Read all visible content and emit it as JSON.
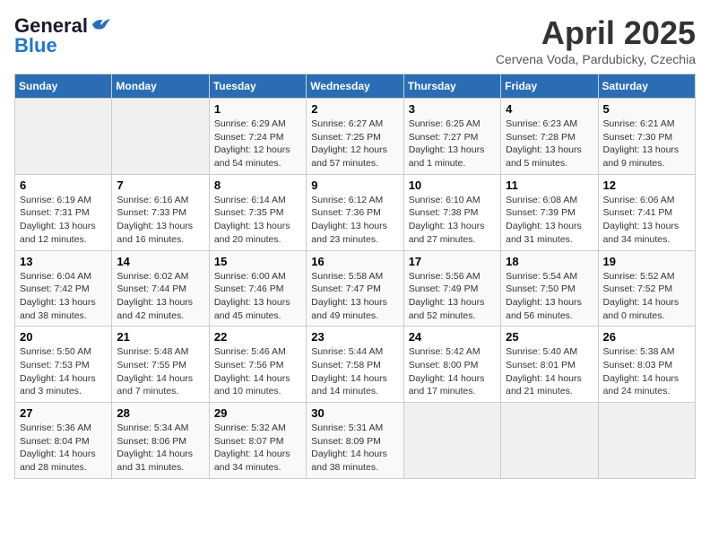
{
  "header": {
    "logo_general": "General",
    "logo_blue": "Blue",
    "title": "April 2025",
    "location": "Cervena Voda, Pardubicky, Czechia"
  },
  "days_of_week": [
    "Sunday",
    "Monday",
    "Tuesday",
    "Wednesday",
    "Thursday",
    "Friday",
    "Saturday"
  ],
  "weeks": [
    [
      {
        "day": "",
        "info": ""
      },
      {
        "day": "",
        "info": ""
      },
      {
        "day": "1",
        "info": "Sunrise: 6:29 AM\nSunset: 7:24 PM\nDaylight: 12 hours and 54 minutes."
      },
      {
        "day": "2",
        "info": "Sunrise: 6:27 AM\nSunset: 7:25 PM\nDaylight: 12 hours and 57 minutes."
      },
      {
        "day": "3",
        "info": "Sunrise: 6:25 AM\nSunset: 7:27 PM\nDaylight: 13 hours and 1 minute."
      },
      {
        "day": "4",
        "info": "Sunrise: 6:23 AM\nSunset: 7:28 PM\nDaylight: 13 hours and 5 minutes."
      },
      {
        "day": "5",
        "info": "Sunrise: 6:21 AM\nSunset: 7:30 PM\nDaylight: 13 hours and 9 minutes."
      }
    ],
    [
      {
        "day": "6",
        "info": "Sunrise: 6:19 AM\nSunset: 7:31 PM\nDaylight: 13 hours and 12 minutes."
      },
      {
        "day": "7",
        "info": "Sunrise: 6:16 AM\nSunset: 7:33 PM\nDaylight: 13 hours and 16 minutes."
      },
      {
        "day": "8",
        "info": "Sunrise: 6:14 AM\nSunset: 7:35 PM\nDaylight: 13 hours and 20 minutes."
      },
      {
        "day": "9",
        "info": "Sunrise: 6:12 AM\nSunset: 7:36 PM\nDaylight: 13 hours and 23 minutes."
      },
      {
        "day": "10",
        "info": "Sunrise: 6:10 AM\nSunset: 7:38 PM\nDaylight: 13 hours and 27 minutes."
      },
      {
        "day": "11",
        "info": "Sunrise: 6:08 AM\nSunset: 7:39 PM\nDaylight: 13 hours and 31 minutes."
      },
      {
        "day": "12",
        "info": "Sunrise: 6:06 AM\nSunset: 7:41 PM\nDaylight: 13 hours and 34 minutes."
      }
    ],
    [
      {
        "day": "13",
        "info": "Sunrise: 6:04 AM\nSunset: 7:42 PM\nDaylight: 13 hours and 38 minutes."
      },
      {
        "day": "14",
        "info": "Sunrise: 6:02 AM\nSunset: 7:44 PM\nDaylight: 13 hours and 42 minutes."
      },
      {
        "day": "15",
        "info": "Sunrise: 6:00 AM\nSunset: 7:46 PM\nDaylight: 13 hours and 45 minutes."
      },
      {
        "day": "16",
        "info": "Sunrise: 5:58 AM\nSunset: 7:47 PM\nDaylight: 13 hours and 49 minutes."
      },
      {
        "day": "17",
        "info": "Sunrise: 5:56 AM\nSunset: 7:49 PM\nDaylight: 13 hours and 52 minutes."
      },
      {
        "day": "18",
        "info": "Sunrise: 5:54 AM\nSunset: 7:50 PM\nDaylight: 13 hours and 56 minutes."
      },
      {
        "day": "19",
        "info": "Sunrise: 5:52 AM\nSunset: 7:52 PM\nDaylight: 14 hours and 0 minutes."
      }
    ],
    [
      {
        "day": "20",
        "info": "Sunrise: 5:50 AM\nSunset: 7:53 PM\nDaylight: 14 hours and 3 minutes."
      },
      {
        "day": "21",
        "info": "Sunrise: 5:48 AM\nSunset: 7:55 PM\nDaylight: 14 hours and 7 minutes."
      },
      {
        "day": "22",
        "info": "Sunrise: 5:46 AM\nSunset: 7:56 PM\nDaylight: 14 hours and 10 minutes."
      },
      {
        "day": "23",
        "info": "Sunrise: 5:44 AM\nSunset: 7:58 PM\nDaylight: 14 hours and 14 minutes."
      },
      {
        "day": "24",
        "info": "Sunrise: 5:42 AM\nSunset: 8:00 PM\nDaylight: 14 hours and 17 minutes."
      },
      {
        "day": "25",
        "info": "Sunrise: 5:40 AM\nSunset: 8:01 PM\nDaylight: 14 hours and 21 minutes."
      },
      {
        "day": "26",
        "info": "Sunrise: 5:38 AM\nSunset: 8:03 PM\nDaylight: 14 hours and 24 minutes."
      }
    ],
    [
      {
        "day": "27",
        "info": "Sunrise: 5:36 AM\nSunset: 8:04 PM\nDaylight: 14 hours and 28 minutes."
      },
      {
        "day": "28",
        "info": "Sunrise: 5:34 AM\nSunset: 8:06 PM\nDaylight: 14 hours and 31 minutes."
      },
      {
        "day": "29",
        "info": "Sunrise: 5:32 AM\nSunset: 8:07 PM\nDaylight: 14 hours and 34 minutes."
      },
      {
        "day": "30",
        "info": "Sunrise: 5:31 AM\nSunset: 8:09 PM\nDaylight: 14 hours and 38 minutes."
      },
      {
        "day": "",
        "info": ""
      },
      {
        "day": "",
        "info": ""
      },
      {
        "day": "",
        "info": ""
      }
    ]
  ]
}
